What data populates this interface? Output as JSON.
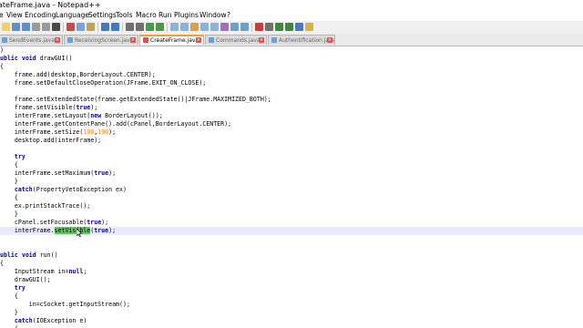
{
  "window": {
    "title": "ateFrame.java - Notepad++"
  },
  "menu": [
    "e",
    "View",
    "Encoding",
    "Language",
    "Settings",
    "Tools",
    "Macro",
    "Run",
    "Plugins",
    "Window",
    "?"
  ],
  "tabs": [
    {
      "label": "SendEvents.java",
      "active": false,
      "icon_color": "#6a9fd8"
    },
    {
      "label": "ReceivingScreen.java",
      "active": false,
      "icon_color": "#6a9fd8"
    },
    {
      "label": "CreateFrame.java",
      "active": true,
      "icon_color": "#d9534f"
    },
    {
      "label": "Commands.java",
      "active": false,
      "icon_color": "#6a9fd8"
    },
    {
      "label": "Authentification.java",
      "active": false,
      "icon_color": "#6a9fd8"
    }
  ],
  "code": [
    ")",
    "ublic void drawGUI()",
    "{",
    "    frame.add(desktop,BorderLayout.CENTER);",
    "    frame.setDefaultCloseOperation(JFrame.EXIT_ON_CLOSE);",
    "",
    "    frame.setExtendedState(frame.getExtendedState()|JFrame.MAXIMIZED_BOTH);",
    "    frame.setVisible(true);",
    "    interFrame.setLayout(new BorderLayout());",
    "    interFrame.getContentPane().add(cPanel,BorderLayout.CENTER);",
    "    interFrame.setSize(100,100);",
    "    desktop.add(interFrame);",
    "",
    "    try",
    "    {",
    "    interFrame.setMaximum(true);",
    "    }",
    "    catch(PropertyVetoException ex)",
    "    {",
    "    ex.printStackTrace();",
    "    }",
    "    cPanel.setFocusable(true);",
    "    interFrame.setVisible(true);",
    "",
    "",
    "ublic void run()",
    "{",
    "    InputStream in=null;",
    "    drawGUI();",
    "    try",
    "    {",
    "        in=cSocket.getInputStream();",
    "    }",
    "    catch(IOException e)",
    "    {"
  ],
  "highlight": {
    "line": 22,
    "text": "setVisible"
  },
  "colors": {
    "toolbar_bg": "#f0f0f0",
    "active_tab_accent": "#f7a12b",
    "keyword": "#00008b",
    "number": "#ff8000",
    "current_line": "#e8e8ff",
    "selection": "#5fc95f"
  }
}
